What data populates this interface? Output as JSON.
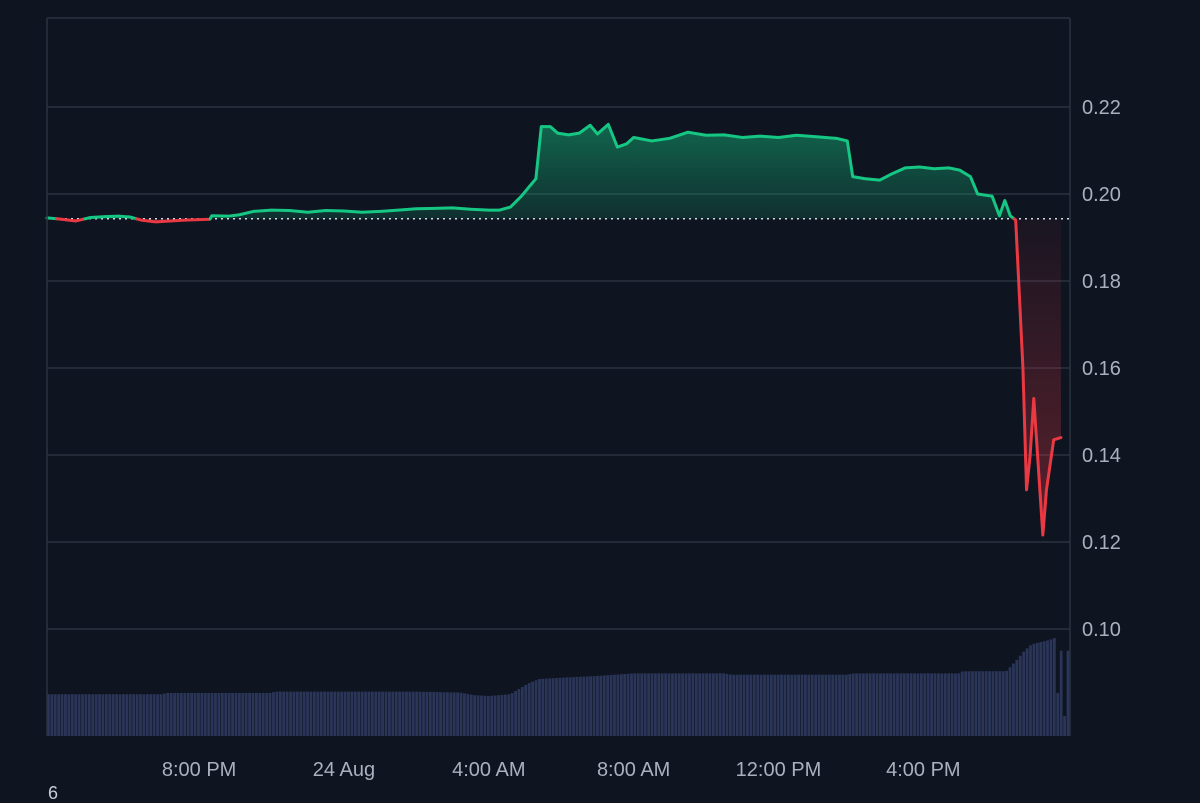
{
  "chart_data": {
    "type": "area",
    "baseline": 0.1943,
    "ylim": [
      0.075,
      0.238
    ],
    "y_ticks": [
      0.1,
      0.12,
      0.14,
      0.16,
      0.18,
      0.2,
      0.22
    ],
    "y_tick_labels": [
      "0.10",
      "0.12",
      "0.14",
      "0.16",
      "0.18",
      "0.20",
      "0.22"
    ],
    "x_range_hours": [
      -4.2,
      21.5
    ],
    "x_ticks": [
      {
        "label": "8:00 PM",
        "h": 0
      },
      {
        "label": "24 Aug",
        "h": 4
      },
      {
        "label": "4:00 AM",
        "h": 8
      },
      {
        "label": "8:00 AM",
        "h": 12
      },
      {
        "label": "12:00 PM",
        "h": 16
      },
      {
        "label": "4:00 PM",
        "h": 20
      }
    ],
    "x_time_labels_hours": "hours from 8:00 PM",
    "price_series": {
      "colors": {
        "above": "#16c784",
        "below": "#ea3943"
      },
      "points": [
        [
          -4.2,
          0.1945
        ],
        [
          -3.8,
          0.1942
        ],
        [
          -3.4,
          0.1938
        ],
        [
          -3.0,
          0.1946
        ],
        [
          -2.6,
          0.1948
        ],
        [
          -2.2,
          0.1949
        ],
        [
          -1.9,
          0.1947
        ],
        [
          -1.6,
          0.194
        ],
        [
          -1.2,
          0.1936
        ],
        [
          -0.8,
          0.1938
        ],
        [
          -0.4,
          0.194
        ],
        [
          0.0,
          0.1941
        ],
        [
          0.3,
          0.1942
        ],
        [
          0.35,
          0.195
        ],
        [
          0.8,
          0.1949
        ],
        [
          1.1,
          0.1952
        ],
        [
          1.5,
          0.196
        ],
        [
          2.0,
          0.1963
        ],
        [
          2.5,
          0.1962
        ],
        [
          3.0,
          0.1958
        ],
        [
          3.5,
          0.1962
        ],
        [
          4.0,
          0.1961
        ],
        [
          4.5,
          0.1958
        ],
        [
          5.0,
          0.196
        ],
        [
          5.5,
          0.1963
        ],
        [
          6.0,
          0.1966
        ],
        [
          6.5,
          0.1967
        ],
        [
          7.0,
          0.1968
        ],
        [
          7.5,
          0.1965
        ],
        [
          8.0,
          0.1963
        ],
        [
          8.3,
          0.1963
        ],
        [
          8.6,
          0.197
        ],
        [
          8.9,
          0.1995
        ],
        [
          9.1,
          0.2015
        ],
        [
          9.2,
          0.2025
        ],
        [
          9.3,
          0.2035
        ],
        [
          9.45,
          0.2155
        ],
        [
          9.7,
          0.2155
        ],
        [
          9.9,
          0.214
        ],
        [
          10.2,
          0.2136
        ],
        [
          10.5,
          0.214
        ],
        [
          10.8,
          0.2158
        ],
        [
          11.0,
          0.2138
        ],
        [
          11.3,
          0.216
        ],
        [
          11.55,
          0.2108
        ],
        [
          11.8,
          0.2115
        ],
        [
          12.0,
          0.213
        ],
        [
          12.5,
          0.2122
        ],
        [
          13.0,
          0.2128
        ],
        [
          13.5,
          0.2142
        ],
        [
          14.0,
          0.2135
        ],
        [
          14.5,
          0.2136
        ],
        [
          15.0,
          0.213
        ],
        [
          15.5,
          0.2133
        ],
        [
          16.0,
          0.213
        ],
        [
          16.5,
          0.2135
        ],
        [
          17.0,
          0.2132
        ],
        [
          17.6,
          0.2128
        ],
        [
          17.9,
          0.2122
        ],
        [
          18.05,
          0.204
        ],
        [
          18.4,
          0.2035
        ],
        [
          18.8,
          0.2032
        ],
        [
          19.1,
          0.2045
        ],
        [
          19.5,
          0.206
        ],
        [
          19.9,
          0.2062
        ],
        [
          20.3,
          0.2058
        ],
        [
          20.7,
          0.206
        ],
        [
          21.0,
          0.2055
        ],
        [
          21.3,
          0.204
        ],
        [
          21.5,
          0.2
        ],
        [
          21.9,
          0.1995
        ],
        [
          22.1,
          0.195
        ],
        [
          22.25,
          0.1985
        ],
        [
          22.4,
          0.195
        ],
        [
          22.55,
          0.194
        ],
        [
          22.75,
          0.16
        ],
        [
          22.85,
          0.132
        ],
        [
          22.95,
          0.14
        ],
        [
          23.05,
          0.153
        ],
        [
          23.3,
          0.1216
        ],
        [
          23.4,
          0.132
        ],
        [
          23.6,
          0.1435
        ],
        [
          23.8,
          0.144
        ]
      ]
    },
    "volume_series": {
      "color": "#2a3558",
      "points": [
        [
          -4.2,
          0.085
        ],
        [
          -1.0,
          0.085
        ],
        [
          -0.9,
          0.0853
        ],
        [
          2.0,
          0.0853
        ],
        [
          2.1,
          0.0856
        ],
        [
          6.0,
          0.0856
        ],
        [
          7.2,
          0.0854
        ],
        [
          7.6,
          0.0848
        ],
        [
          8.0,
          0.0846
        ],
        [
          8.6,
          0.085
        ],
        [
          9.1,
          0.0875
        ],
        [
          9.4,
          0.0885
        ],
        [
          10.0,
          0.0888
        ],
        [
          11.0,
          0.0892
        ],
        [
          12.0,
          0.0898
        ],
        [
          14.5,
          0.0898
        ],
        [
          14.7,
          0.0895
        ],
        [
          16.0,
          0.0895
        ],
        [
          17.9,
          0.0895
        ],
        [
          18.1,
          0.0898
        ],
        [
          19.0,
          0.0898
        ],
        [
          21.0,
          0.0898
        ],
        [
          21.1,
          0.0903
        ],
        [
          22.3,
          0.0903
        ],
        [
          22.6,
          0.093
        ],
        [
          22.8,
          0.095
        ],
        [
          23.0,
          0.0965
        ],
        [
          23.5,
          0.0975
        ],
        [
          23.65,
          0.098
        ],
        [
          23.75,
          0.08
        ],
        [
          23.8,
          0.095
        ]
      ]
    }
  },
  "overflow_label": "6"
}
